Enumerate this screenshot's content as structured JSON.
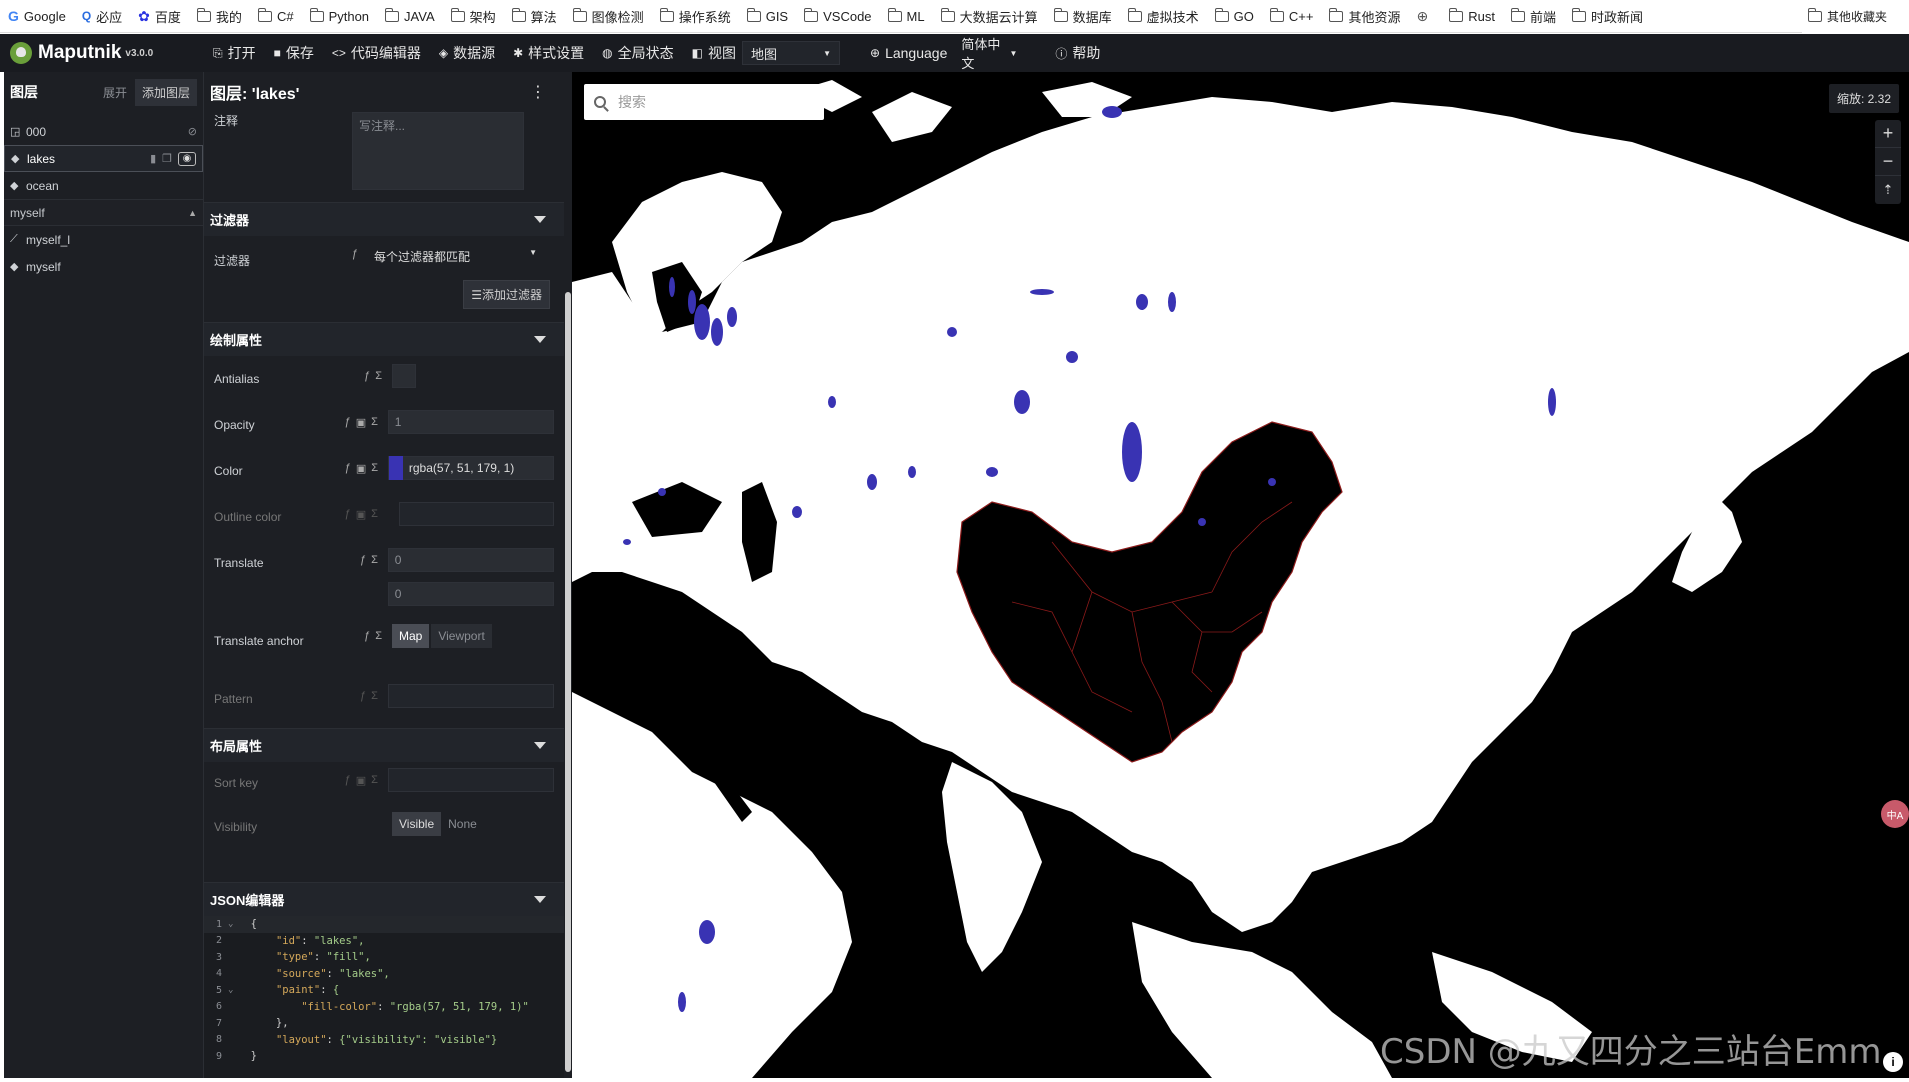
{
  "bookmarks": [
    {
      "label": "Google",
      "icon": "google-icon"
    },
    {
      "label": "必应",
      "icon": "bing-icon"
    },
    {
      "label": "百度",
      "icon": "baidu-icon"
    },
    {
      "label": "我的",
      "icon": "folder-icon"
    },
    {
      "label": "C#",
      "icon": "folder-icon"
    },
    {
      "label": "Python",
      "icon": "folder-icon"
    },
    {
      "label": "JAVA",
      "icon": "folder-icon"
    },
    {
      "label": "架构",
      "icon": "folder-icon"
    },
    {
      "label": "算法",
      "icon": "folder-icon"
    },
    {
      "label": "图像检测",
      "icon": "folder-icon"
    },
    {
      "label": "操作系统",
      "icon": "folder-icon"
    },
    {
      "label": "GIS",
      "icon": "folder-icon"
    },
    {
      "label": "VSCode",
      "icon": "folder-icon"
    },
    {
      "label": "ML",
      "icon": "folder-icon"
    },
    {
      "label": "大数据云计算",
      "icon": "folder-icon"
    },
    {
      "label": "数据库",
      "icon": "folder-icon"
    },
    {
      "label": "虚拟技术",
      "icon": "folder-icon"
    },
    {
      "label": "GO",
      "icon": "folder-icon"
    },
    {
      "label": "C++",
      "icon": "folder-icon"
    },
    {
      "label": "其他资源",
      "icon": "folder-icon"
    },
    {
      "label": "",
      "icon": "globe-icon"
    },
    {
      "label": "Rust",
      "icon": "folder-icon"
    },
    {
      "label": "前端",
      "icon": "folder-icon"
    },
    {
      "label": "时政新闻",
      "icon": "folder-icon"
    }
  ],
  "bookmarks_more": ">",
  "bookmarks_other": "其他收藏夹",
  "app": {
    "name": "Maputnik",
    "version": "v3.0.0"
  },
  "toolbar": {
    "open": "打开",
    "save": "保存",
    "code_editor": "代码编辑器",
    "data_sources": "数据源",
    "style_settings": "样式设置",
    "global_state": "全局状态",
    "view": "视图",
    "view_value": "地图",
    "language": "Language",
    "language_value": "简体中文",
    "help": "帮助"
  },
  "layers": {
    "title": "图层",
    "expand": "展开",
    "add": "添加图层",
    "items": [
      {
        "name": "000",
        "type": "background"
      },
      {
        "name": "lakes",
        "type": "fill",
        "selected": true
      },
      {
        "name": "ocean",
        "type": "fill"
      }
    ],
    "group": "myself",
    "group_items": [
      {
        "name": "myself_l",
        "type": "line"
      },
      {
        "name": "myself",
        "type": "fill"
      }
    ]
  },
  "editor": {
    "title": "图层: 'lakes'",
    "comment_label": "注释",
    "comment_placeholder": "写注释...",
    "filter_section": "过滤器",
    "filter_label": "过滤器",
    "filter_value": "每个过滤器都匹配",
    "add_filter": "添加过滤器",
    "paint_section": "绘制属性",
    "antialias": "Antialias",
    "opacity": "Opacity",
    "opacity_value": "1",
    "color": "Color",
    "color_value": "rgba(57, 51, 179, 1)",
    "color_swatch": "#3933b3",
    "outline_color": "Outline color",
    "translate": "Translate",
    "translate_x": "0",
    "translate_y": "0",
    "translate_anchor": "Translate anchor",
    "anchor_map": "Map",
    "anchor_viewport": "Viewport",
    "pattern": "Pattern",
    "layout_section": "布局属性",
    "sort_key": "Sort key",
    "visibility": "Visibility",
    "vis_visible": "Visible",
    "vis_none": "None",
    "json_section": "JSON编辑器"
  },
  "json_lines": [
    {
      "n": "1",
      "fold": true,
      "text": "{"
    },
    {
      "n": "2",
      "key": "\"id\"",
      "val": "\"lakes\","
    },
    {
      "n": "3",
      "key": "\"type\"",
      "val": "\"fill\","
    },
    {
      "n": "4",
      "key": "\"source\"",
      "val": "\"lakes\","
    },
    {
      "n": "5",
      "fold": true,
      "key": "\"paint\"",
      "val": "{"
    },
    {
      "n": "6",
      "key": "\"fill-color\"",
      "val": "\"rgba(57, 51, 179, 1)\"",
      "indent": 2
    },
    {
      "n": "7",
      "text": "},",
      "indent": 1
    },
    {
      "n": "8",
      "key": "\"layout\"",
      "val": "{\"visibility\": \"visible\"}"
    },
    {
      "n": "9",
      "text": "}"
    }
  ],
  "map": {
    "search_placeholder": "搜索",
    "zoom_label": "缩放: 2.32",
    "zoom_in": "+",
    "zoom_out": "−",
    "compass": "⇡",
    "translate_badge": "中A",
    "watermark": "CSDN @九又四分之三站台Emm",
    "info": "i",
    "land_color": "#ffffff",
    "ocean_color": "#000000",
    "lake_color": "#3933b3",
    "boundary_color": "#8b1a1a"
  }
}
